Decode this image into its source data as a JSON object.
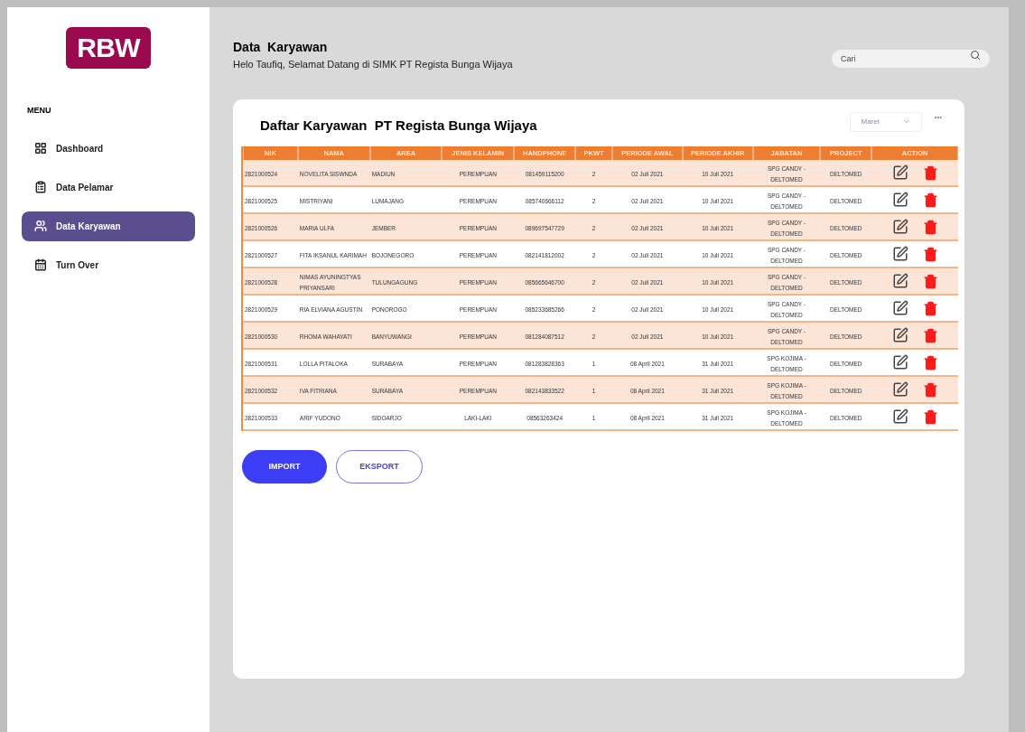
{
  "sidebar": {
    "logo": "RBW",
    "menu_label": "MENU",
    "items": [
      {
        "label": "Dashboard",
        "selected": false
      },
      {
        "label": "Data Pelamar",
        "selected": false
      },
      {
        "label": "Data Karyawan",
        "selected": true
      },
      {
        "label": "Turn Over",
        "selected": false
      }
    ]
  },
  "header": {
    "title": "Data  Karyawan",
    "subtitle": "Helo Taufiq, Selamat Datang di SIMK PT Regista Bunga Wijaya",
    "search": {
      "placeholder": "Cari"
    }
  },
  "card": {
    "title": "Daftar Karyawan  PT Regista Bunga Wijaya",
    "filter": "Maret",
    "more": "•••",
    "table": {
      "columns": [
        "NIK",
        "NAMA",
        "AREA",
        "JENIS KELAMIN",
        "HANDPHONE",
        "PKWT",
        "PERIODE AWAL",
        "PERIODE AKHIR",
        "JABATAN",
        "PROJECT",
        "ACTION"
      ],
      "rows": [
        [
          "2821000524",
          "NOVELITA SISWNDA",
          "MADIUN",
          "PEREMPUAN",
          "081459115200",
          "2",
          "02 Juli 2021",
          "10 Juli 2021",
          "SPG CANDY - DELTOMED",
          "DELTOMED"
        ],
        [
          "2821000525",
          "MISTRIYANI",
          "LUMAJANG",
          "PEREMPUAN",
          "085740666112",
          "2",
          "02 Juli 2021",
          "10 Juli 2021",
          "SPG CANDY - DELTOMED",
          "DELTOMED"
        ],
        [
          "2821000526",
          "MARIA ULFA",
          "JEMBER",
          "PEREMPUAN",
          "089697547729",
          "2",
          "02 Juli 2021",
          "10 Juli 2021",
          "SPG CANDY - DELTOMED",
          "DELTOMED"
        ],
        [
          "2821000527",
          "FITA IKSANUL KARIMAH",
          "BOJONEGORO",
          "PEREMPUAN",
          "082141812002",
          "2",
          "02 Juli 2021",
          "10 Juli 2021",
          "SPG CANDY - DELTOMED",
          "DELTOMED"
        ],
        [
          "2821000528",
          "NIMAS AYUNINGTYAS PRIYANSARI",
          "TULUNGAGUNG",
          "PEREMPUAN",
          "085665646700",
          "2",
          "02 Juli 2021",
          "10 Juli 2021",
          "SPG CANDY - DELTOMED",
          "DELTOMED"
        ],
        [
          "2821000529",
          "RIA ELVIANA AGUSTIN",
          "PONOROGO",
          "PEREMPUAN",
          "085233685266",
          "2",
          "02 Juli 2021",
          "10 Juli 2021",
          "SPG CANDY - DELTOMED",
          "DELTOMED"
        ],
        [
          "2821000530",
          "RHOMA WAHAYATI",
          "BANYUWANGI",
          "PEREMPUAN",
          "081284087512",
          "2",
          "02 Juli 2021",
          "10 Juli 2021",
          "SPG CANDY - DELTOMED",
          "DELTOMED"
        ],
        [
          "2821000531",
          "LOLLA PITALOKA",
          "SURABAYA",
          "PEREMPUAN",
          "081283828363",
          "1",
          "08 April 2021",
          "31 Juli 2021",
          "SPG KOJIMA - DELTOMED",
          "DELTOMED"
        ],
        [
          "2821000532",
          "IVA FITRIANA",
          "SURABAYA",
          "PEREMPUAN",
          "082143833522",
          "1",
          "08 April 2021",
          "31 Juli 2021",
          "SPG KOJIMA - DELTOMED",
          "DELTOMED"
        ],
        [
          "2821000533",
          "ARIF YUDONO",
          "SIDOARJO",
          "LAKI-LAKI",
          "08563263424",
          "1",
          "08 April 2021",
          "31 Juli 2021",
          "SPG KOJIMA - DELTOMED",
          "DELTOMED"
        ]
      ]
    }
  },
  "buttons": [
    {
      "label": "IMPORT",
      "kind": "primary"
    },
    {
      "label": "EKSPORT",
      "kind": "outline"
    }
  ]
}
